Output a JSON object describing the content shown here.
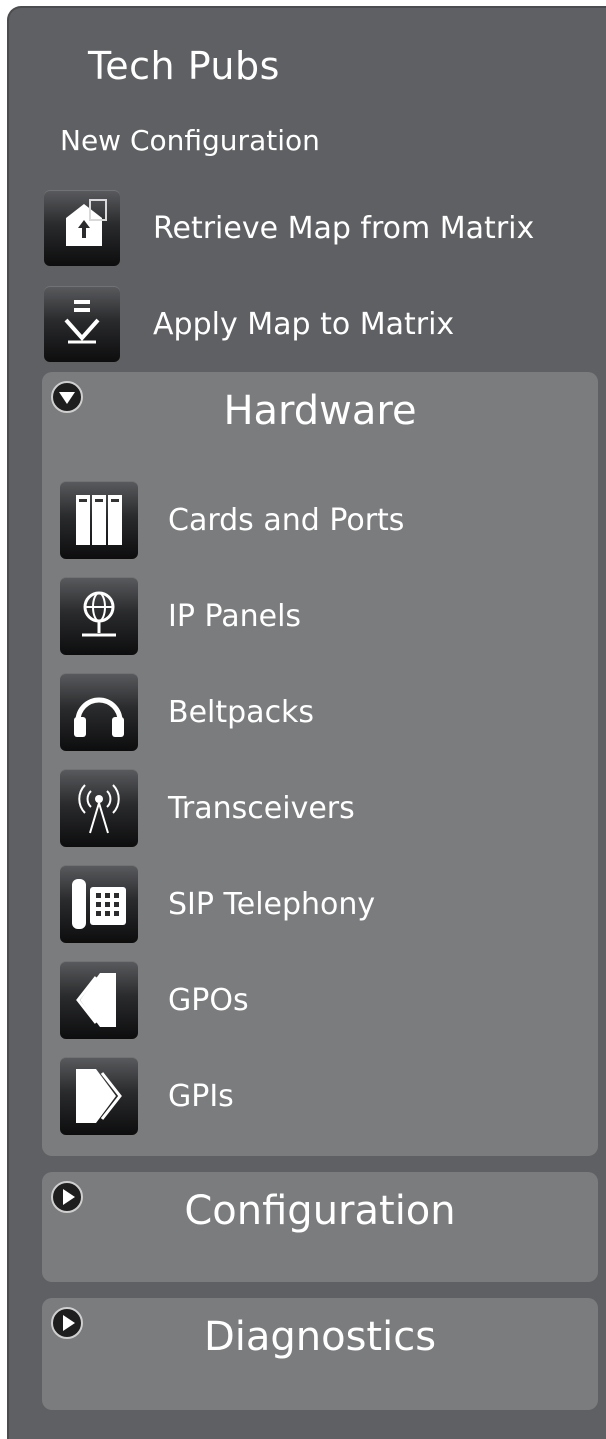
{
  "app": {
    "title": "Tech Pubs",
    "new_configuration": "New Configuration"
  },
  "actions": [
    {
      "label": "Retrieve Map from Matrix",
      "icon": "retrieve-map-icon"
    },
    {
      "label": "Apply Map to Matrix",
      "icon": "apply-map-icon"
    }
  ],
  "groups": {
    "hardware": {
      "title": "Hardware",
      "expanded": true,
      "items": [
        {
          "label": "Cards and Ports",
          "icon": "cards-ports-icon"
        },
        {
          "label": "IP Panels",
          "icon": "ip-panels-icon"
        },
        {
          "label": "Beltpacks",
          "icon": "headphones-icon"
        },
        {
          "label": "Transceivers",
          "icon": "antenna-icon"
        },
        {
          "label": "SIP Telephony",
          "icon": "telephone-icon"
        },
        {
          "label": "GPOs",
          "icon": "arrow-left-icon"
        },
        {
          "label": "GPIs",
          "icon": "arrow-right-icon"
        }
      ]
    },
    "configuration": {
      "title": "Configuration",
      "expanded": false
    },
    "diagnostics": {
      "title": "Diagnostics",
      "expanded": false
    }
  },
  "colors": {
    "panel_bg": "#5f6063",
    "group_bg": "#7b7c7e",
    "text": "#ffffff"
  }
}
